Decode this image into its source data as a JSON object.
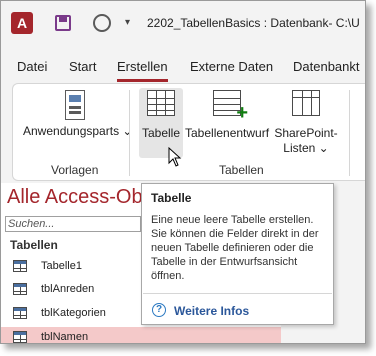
{
  "titlebar": {
    "app_icon": "A",
    "title": "2202_TabellenBasics : Datenbank- C:\\U"
  },
  "tabs": [
    {
      "label": "Datei"
    },
    {
      "label": "Start"
    },
    {
      "label": "Erstellen"
    },
    {
      "label": "Externe Daten"
    },
    {
      "label": "Datenbankt"
    }
  ],
  "ribbon": {
    "vorlagen": {
      "label": "Vorlagen",
      "anwendungsparts": "Anwendungsparts ⌄"
    },
    "tabellen": {
      "label": "Tabellen",
      "tabelle": "Tabelle",
      "tabellenentwurf": "Tabellenentwurf",
      "sharepoint_line1": "SharePoint-",
      "sharepoint_line2": "Listen ⌄"
    }
  },
  "nav": {
    "title": "Alle Access-Ob",
    "search_placeholder": "Suchen...",
    "group": "Tabellen",
    "items": [
      "Tabelle1",
      "tblAnreden",
      "tblKategorien",
      "tblNamen"
    ]
  },
  "tooltip": {
    "title": "Tabelle",
    "body": "Eine neue leere Tabelle erstellen. Sie können die Felder direkt in der neuen Tabelle definieren oder die Tabelle in der Entwurfsansicht öffnen.",
    "link": "Weitere Infos"
  },
  "colors": {
    "accent": "#a4262c",
    "link": "#2b579a",
    "selection": "#f4c9c9"
  }
}
